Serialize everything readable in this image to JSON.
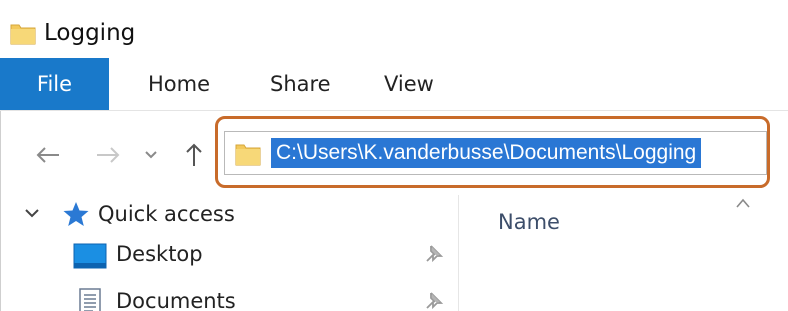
{
  "window": {
    "title": "Logging"
  },
  "ribbon": {
    "tabs": [
      {
        "label": "File",
        "active": true
      },
      {
        "label": "Home",
        "active": false
      },
      {
        "label": "Share",
        "active": false
      },
      {
        "label": "View",
        "active": false
      }
    ]
  },
  "navigation": {
    "back_icon": "arrow-left-icon",
    "forward_icon": "arrow-right-icon",
    "recent_icon": "chevron-down-icon",
    "up_icon": "arrow-up-icon"
  },
  "address_bar": {
    "path": "C:\\Users\\K.vanderbusse\\Documents\\Logging",
    "selected": true,
    "folder_icon": "folder-icon",
    "highlight_color": "#c86b2a",
    "selection_color": "#2a77d4"
  },
  "nav_pane": {
    "quick_access_label": "Quick access",
    "items": [
      {
        "label": "Desktop",
        "icon": "desktop-icon",
        "pinned": true
      },
      {
        "label": "Documents",
        "icon": "documents-icon",
        "pinned": true
      }
    ]
  },
  "content": {
    "columns": [
      {
        "label": "Name",
        "sorted": "ascending"
      }
    ]
  },
  "colors": {
    "accent": "#1979ca",
    "folder": "#f3c95c"
  }
}
